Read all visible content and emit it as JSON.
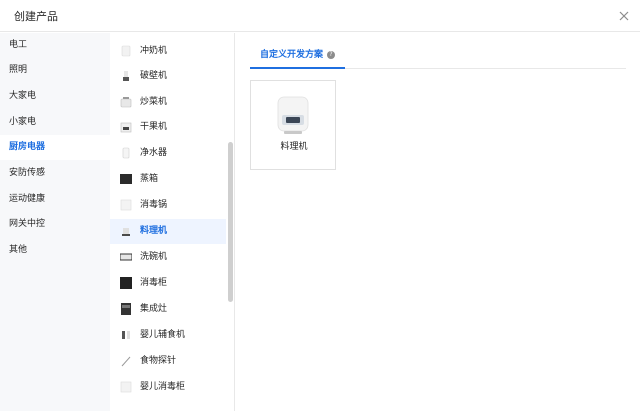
{
  "header": {
    "title": "创建产品",
    "close_icon": "close-icon"
  },
  "categories": [
    {
      "label": "电工"
    },
    {
      "label": "照明"
    },
    {
      "label": "大家电"
    },
    {
      "label": "小家电"
    },
    {
      "label": "厨房电器",
      "active": true
    },
    {
      "label": "安防传感"
    },
    {
      "label": "运动健康"
    },
    {
      "label": "网关中控"
    },
    {
      "label": "其他"
    }
  ],
  "products": [
    {
      "label": "冲奶机"
    },
    {
      "label": "破壁机"
    },
    {
      "label": "炒菜机"
    },
    {
      "label": "干果机"
    },
    {
      "label": "净水器"
    },
    {
      "label": "蒸箱"
    },
    {
      "label": "消毒锅"
    },
    {
      "label": "料理机",
      "active": true
    },
    {
      "label": "洗碗机"
    },
    {
      "label": "消毒柜"
    },
    {
      "label": "集成灶"
    },
    {
      "label": "婴儿辅食机"
    },
    {
      "label": "食物探针"
    },
    {
      "label": "婴儿消毒柜"
    }
  ],
  "tabs": [
    {
      "label": "自定义开发方案",
      "active": true
    }
  ],
  "solution_card": {
    "label": "料理机"
  },
  "colors": {
    "accent": "#1f6fe0",
    "active_row_bg": "#eef4ff",
    "sidebar_bg": "#f7f8fa",
    "border": "#e8e8e8"
  }
}
